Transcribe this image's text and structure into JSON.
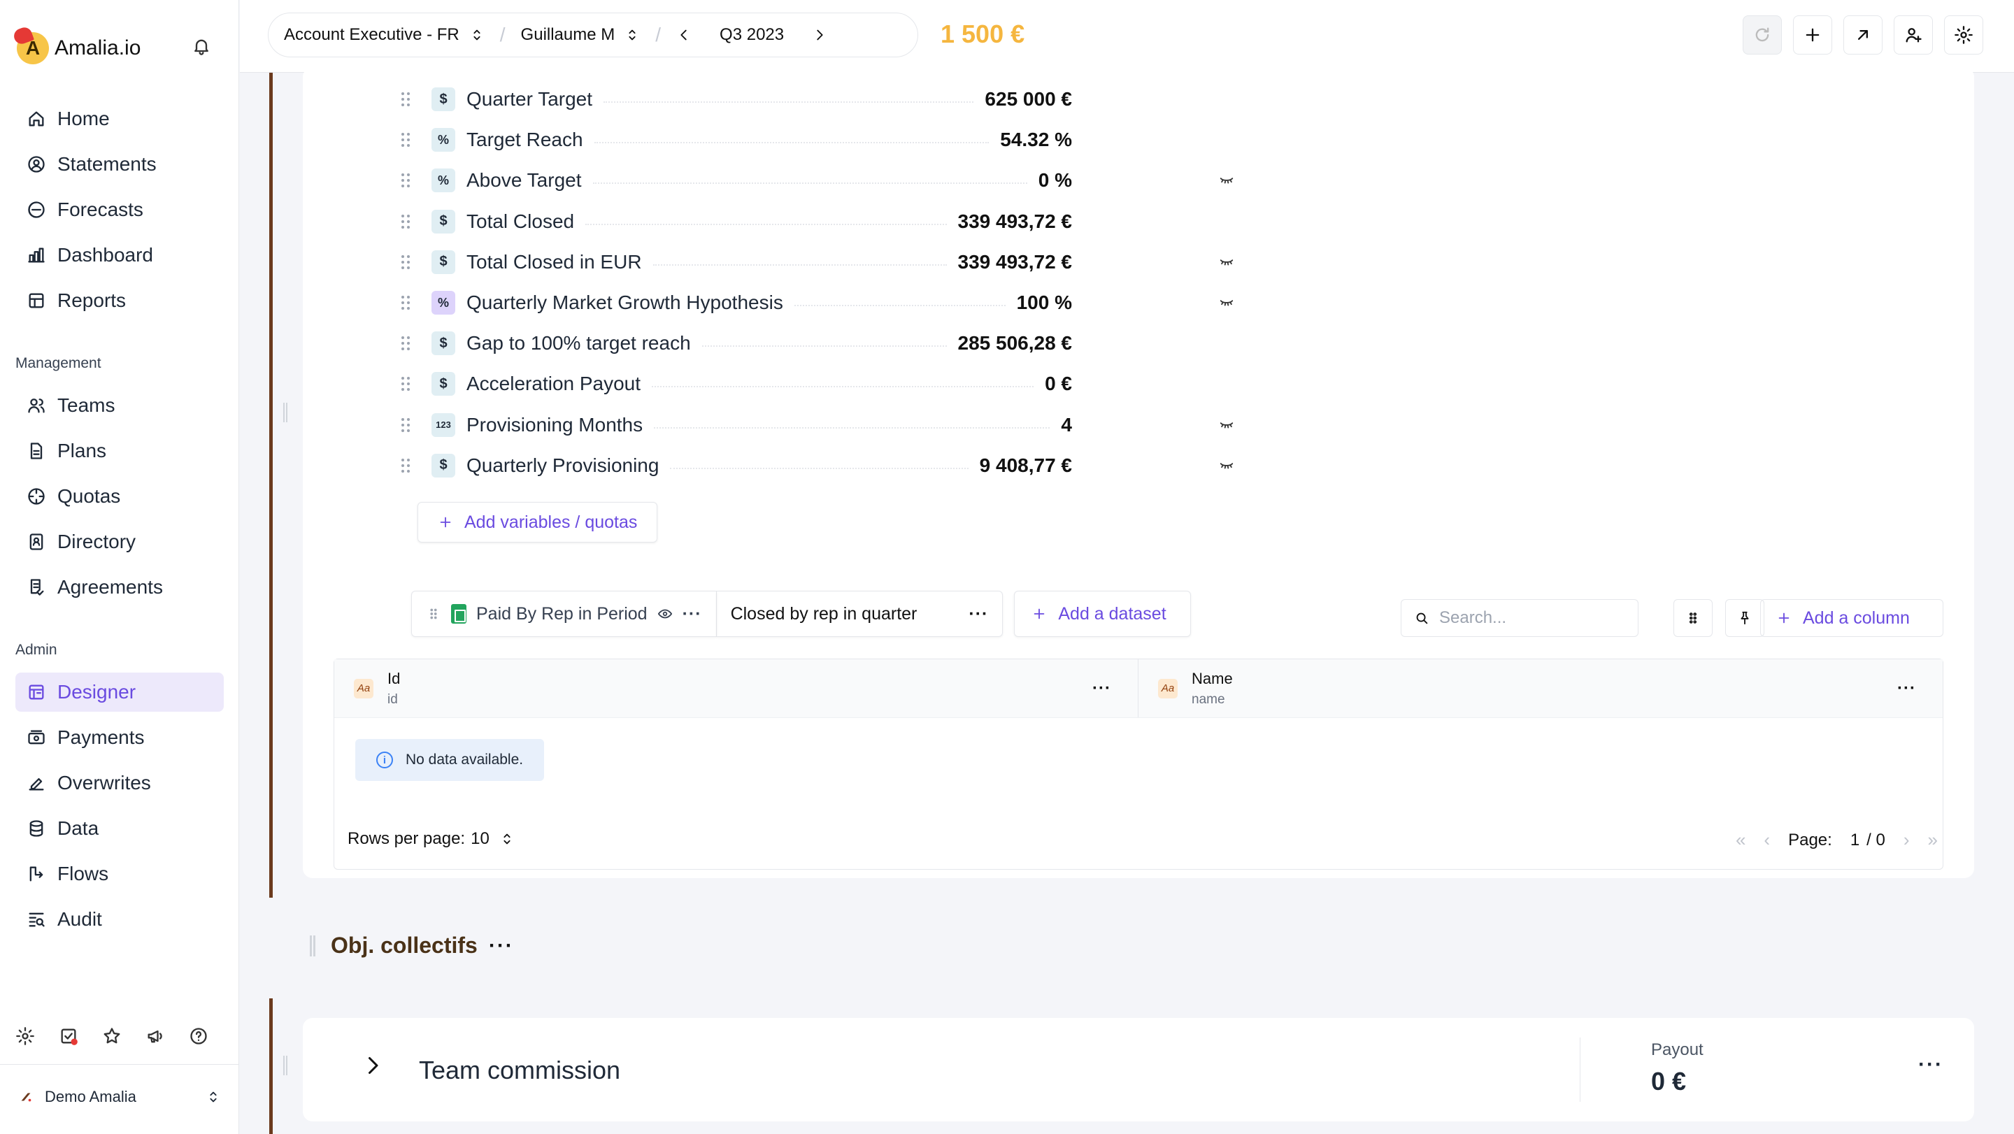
{
  "brand": {
    "name": "Amalia.io",
    "mark": "A"
  },
  "sidebar": {
    "main": [
      {
        "label": "Home",
        "icon": "home-icon"
      },
      {
        "label": "Statements",
        "icon": "user-circle-icon"
      },
      {
        "label": "Forecasts",
        "icon": "forecast-icon"
      },
      {
        "label": "Dashboard",
        "icon": "bar-chart-icon"
      },
      {
        "label": "Reports",
        "icon": "table-icon"
      }
    ],
    "management_label": "Management",
    "management": [
      {
        "label": "Teams",
        "icon": "users-icon"
      },
      {
        "label": "Plans",
        "icon": "document-icon"
      },
      {
        "label": "Quotas",
        "icon": "target-icon"
      },
      {
        "label": "Directory",
        "icon": "directory-icon"
      },
      {
        "label": "Agreements",
        "icon": "agreement-icon"
      }
    ],
    "admin_label": "Admin",
    "admin": [
      {
        "label": "Designer",
        "icon": "designer-icon",
        "active": true
      },
      {
        "label": "Payments",
        "icon": "payments-icon"
      },
      {
        "label": "Overwrites",
        "icon": "overwrite-icon"
      },
      {
        "label": "Data",
        "icon": "database-icon"
      },
      {
        "label": "Flows",
        "icon": "flow-icon"
      },
      {
        "label": "Audit",
        "icon": "audit-icon"
      }
    ],
    "org_name": "Demo Amalia"
  },
  "topbar": {
    "plan": "Account Executive - FR",
    "user": "Guillaume M",
    "period": "Q3 2023",
    "total": "1 500 €"
  },
  "variables": [
    {
      "name": "Quarter Target",
      "type": "$",
      "value": "625 000 €",
      "hidden": false
    },
    {
      "name": "Target Reach",
      "type": "%",
      "value": "54.32 %",
      "hidden": false
    },
    {
      "name": "Above Target",
      "type": "%",
      "value": "0 %",
      "hidden": true
    },
    {
      "name": "Total Closed",
      "type": "$",
      "value": "339 493,72 €",
      "hidden": false
    },
    {
      "name": "Total Closed in EUR",
      "type": "$",
      "value": "339 493,72 €",
      "hidden": true
    },
    {
      "name": "Quarterly Market Growth Hypothesis",
      "type": "%",
      "value": "100 %",
      "hidden": true,
      "purple": true
    },
    {
      "name": "Gap to 100% target reach",
      "type": "$",
      "value": "285 506,28 €",
      "hidden": false
    },
    {
      "name": "Acceleration Payout",
      "type": "$",
      "value": "0 €",
      "hidden": false
    },
    {
      "name": "Provisioning Months",
      "type": "123",
      "value": "4",
      "hidden": true
    },
    {
      "name": "Quarterly Provisioning",
      "type": "$",
      "value": "9 408,77 €",
      "hidden": true
    }
  ],
  "add_variables_label": "Add variables / quotas",
  "datasets": {
    "tab1": "Paid By Rep in Period",
    "tab2": "Closed by rep in quarter",
    "add_label": "Add a dataset",
    "search_placeholder": "Search...",
    "add_column_label": "Add a column"
  },
  "table": {
    "columns": [
      {
        "name": "Id",
        "sub": "id"
      },
      {
        "name": "Name",
        "sub": "name"
      }
    ],
    "empty": "No data available."
  },
  "pagination": {
    "rows_label": "Rows per page:",
    "rows_value": "10",
    "page_label": "Page:",
    "page_current": "1",
    "page_total": "/ 0"
  },
  "group": {
    "title": "Obj. collectifs",
    "more": "···"
  },
  "rule": {
    "title": "Team commission",
    "payout_label": "Payout",
    "payout_value": "0 €"
  }
}
